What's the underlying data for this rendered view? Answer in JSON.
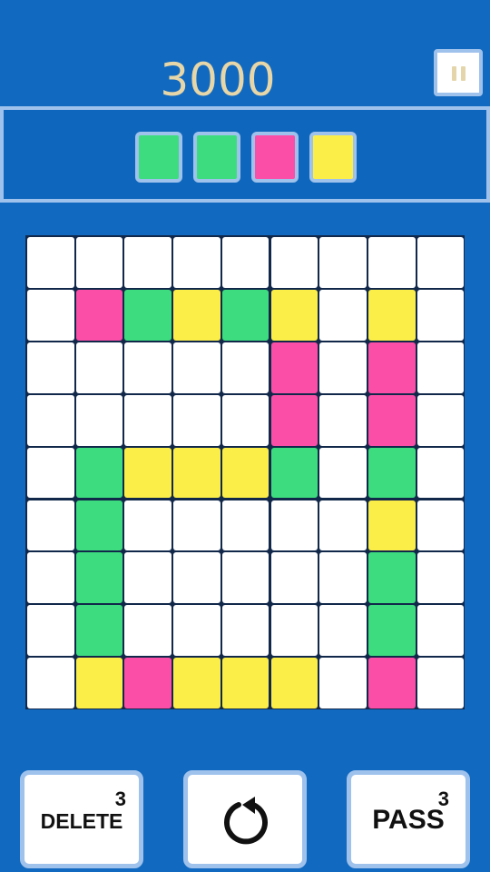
{
  "score": "3000",
  "colors": {
    "W": "#ffffff",
    "G": "#3ddc7e",
    "P": "#fb4ea6",
    "Y": "#fcee48"
  },
  "queue": [
    "G",
    "G",
    "P",
    "Y"
  ],
  "board": [
    [
      "W",
      "W",
      "W",
      "W",
      "W",
      "W",
      "W",
      "W",
      "W"
    ],
    [
      "W",
      "P",
      "G",
      "Y",
      "G",
      "Y",
      "W",
      "Y",
      "W"
    ],
    [
      "W",
      "W",
      "W",
      "W",
      "W",
      "P",
      "W",
      "P",
      "W"
    ],
    [
      "W",
      "W",
      "W",
      "W",
      "W",
      "P",
      "W",
      "P",
      "W"
    ],
    [
      "W",
      "G",
      "Y",
      "Y",
      "Y",
      "G",
      "W",
      "G",
      "W"
    ],
    [
      "W",
      "G",
      "W",
      "W",
      "W",
      "W",
      "W",
      "Y",
      "W"
    ],
    [
      "W",
      "G",
      "W",
      "W",
      "W",
      "W",
      "W",
      "G",
      "W"
    ],
    [
      "W",
      "G",
      "W",
      "W",
      "W",
      "W",
      "W",
      "G",
      "W"
    ],
    [
      "W",
      "Y",
      "P",
      "Y",
      "Y",
      "Y",
      "W",
      "P",
      "W"
    ]
  ],
  "buttons": {
    "delete": {
      "label": "DELETE",
      "count": "3"
    },
    "rotate": {
      "icon": "rotate-icon"
    },
    "pass": {
      "label": "PASS",
      "count": "3"
    }
  },
  "icons": {
    "pause": "pause-icon"
  }
}
